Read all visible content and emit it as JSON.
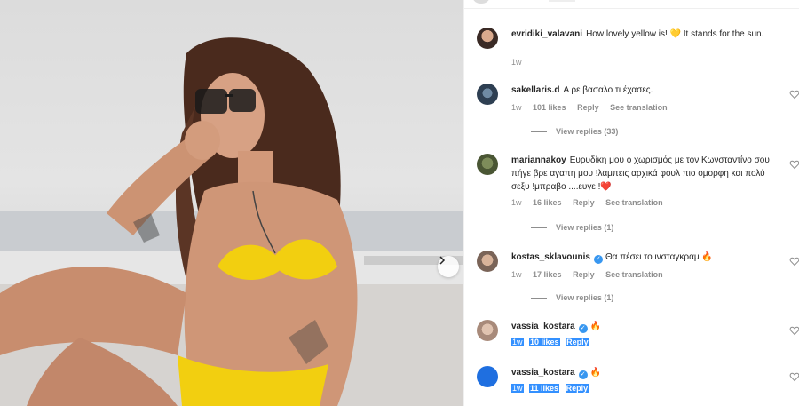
{
  "post": {
    "photo_alt": "Woman in yellow bikini with sunglasses"
  },
  "caption": {
    "username": "evridiki_valavani",
    "text": "How lovely yellow is! 💛 It stands for the sun.",
    "time": "1w"
  },
  "comments": [
    {
      "username": "sakellaris.d",
      "verified": false,
      "text": "Α ρε βασαλο τι έχασες.",
      "time": "1w",
      "likes": "101 likes",
      "reply": "Reply",
      "translate": "See translation",
      "replies": "View replies (33)"
    },
    {
      "username": "mariannakoy",
      "verified": false,
      "text": "Ευρυδίκη μου ο χωρισμός με τον Κωνσταντίνο σου πήγε βρε αγαπη μου !λαμπεις αρχικά φουλ πιο ομορφη και πολύ σεξυ !μπραβο ....ευγε !❤️",
      "time": "1w",
      "likes": "16 likes",
      "reply": "Reply",
      "translate": "See translation",
      "replies": "View replies (1)"
    },
    {
      "username": "kostas_sklavounis",
      "verified": true,
      "text": "Θα πέσει το ινσταγκραμ 🔥",
      "time": "1w",
      "likes": "17 likes",
      "reply": "Reply",
      "translate": "See translation",
      "replies": "View replies (1)"
    },
    {
      "username": "vassia_kostara",
      "verified": true,
      "text": "🔥",
      "time": "1w",
      "likes": "10 likes",
      "reply": "Reply"
    },
    {
      "username": "vassia_kostara",
      "verified": true,
      "text": "🔥",
      "time": "1w",
      "likes": "11 likes",
      "reply": "Reply"
    }
  ],
  "colors": {
    "accent": "#3897f0",
    "selection": "#3390ff",
    "muted": "#8e8e8e",
    "heart": "#ed4956"
  }
}
